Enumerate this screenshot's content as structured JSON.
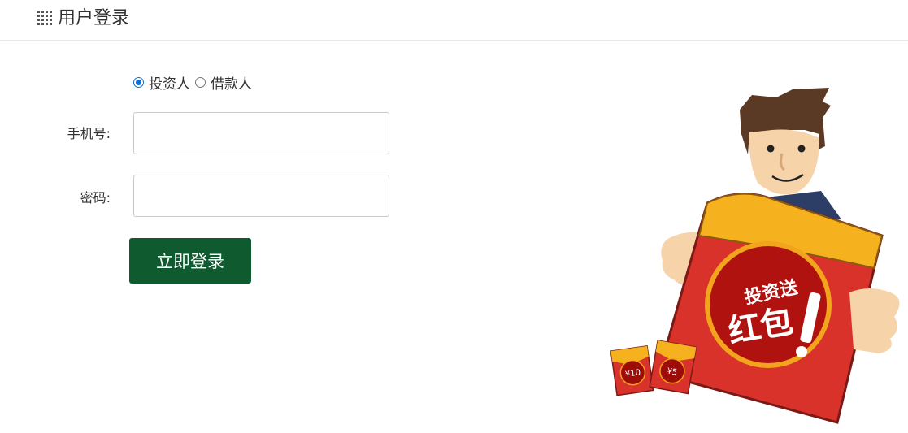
{
  "header": {
    "title": "用户登录",
    "icon": "grid-icon"
  },
  "login_form": {
    "role_options": [
      {
        "label": "投资人",
        "selected": true
      },
      {
        "label": "借款人",
        "selected": false
      }
    ],
    "phone": {
      "label": "手机号:",
      "value": "",
      "placeholder": ""
    },
    "password": {
      "label": "密码:",
      "value": "",
      "placeholder": ""
    },
    "submit_label": "立即登录"
  },
  "illustration": {
    "envelope_text_line1": "投资送",
    "envelope_text_line2": "红包",
    "small_packet_1": "¥10",
    "small_packet_2": "¥5"
  },
  "colors": {
    "button": "#0f5a2f",
    "radio_accent": "#0b6fd8",
    "envelope_red": "#e23b2e",
    "envelope_gold": "#f5b21e"
  }
}
